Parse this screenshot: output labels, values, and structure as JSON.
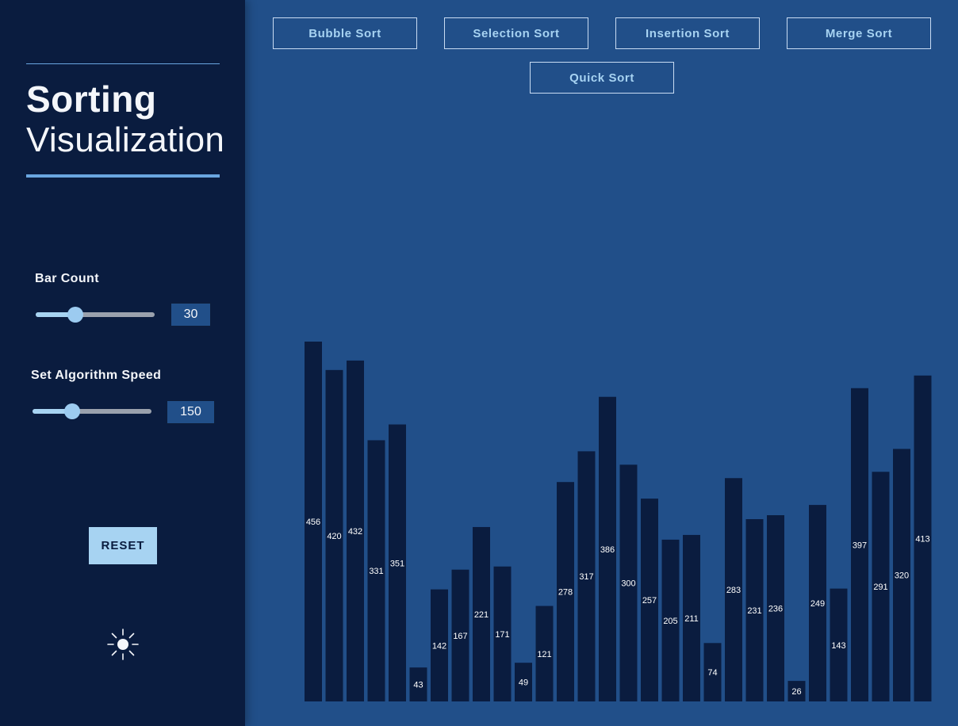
{
  "sidebar": {
    "title_bold": "Sorting",
    "title_light": "Visualization",
    "bar_count_label": "Bar Count",
    "bar_count_value": "30",
    "bar_count_level": 0.33,
    "speed_label": "Set Algorithm Speed",
    "speed_value": "150",
    "speed_level": 0.33,
    "reset_label": "RESET",
    "theme_icon": "sun-icon"
  },
  "algorithms": [
    {
      "label": "Bubble Sort"
    },
    {
      "label": "Selection Sort"
    },
    {
      "label": "Insertion Sort"
    },
    {
      "label": "Merge Sort"
    },
    {
      "label": "Quick Sort"
    }
  ],
  "colors": {
    "background": "#214f89",
    "sidebar": "#0a1c3f",
    "accent": "#a7d3f2",
    "bar": "#0a1c3f",
    "bar_label": "#ffffff"
  },
  "chart_data": {
    "type": "bar",
    "values": [
      456,
      420,
      432,
      331,
      351,
      43,
      142,
      167,
      221,
      171,
      49,
      121,
      278,
      317,
      386,
      300,
      257,
      205,
      211,
      74,
      283,
      231,
      236,
      26,
      249,
      143,
      397,
      291,
      320,
      413
    ]
  }
}
